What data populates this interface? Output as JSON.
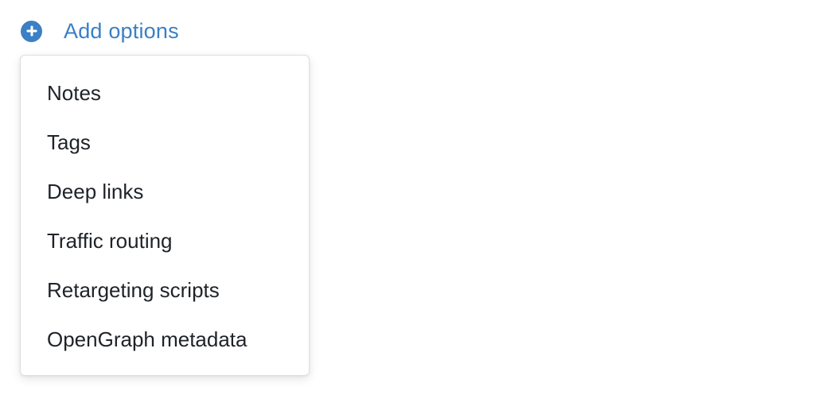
{
  "add_options": {
    "icon": "plus-circle-icon",
    "label": "Add options",
    "accent_color": "#3b7fc4"
  },
  "menu": {
    "items": [
      {
        "label": "Notes"
      },
      {
        "label": "Tags"
      },
      {
        "label": "Deep links"
      },
      {
        "label": "Traffic routing"
      },
      {
        "label": "Retargeting scripts"
      },
      {
        "label": "OpenGraph metadata"
      }
    ]
  }
}
